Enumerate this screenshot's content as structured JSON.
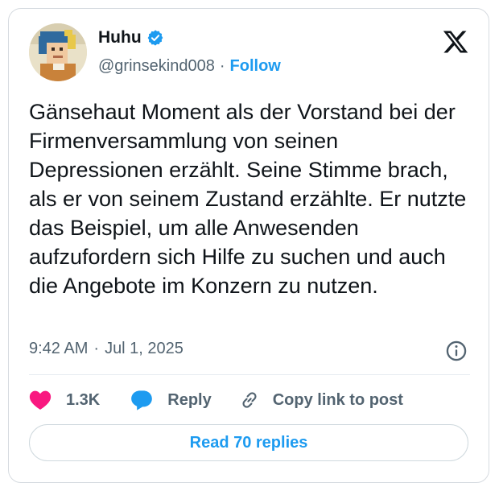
{
  "author": {
    "display_name": "Huhu",
    "handle": "@grinsekind008",
    "separator": "·",
    "follow_label": "Follow",
    "verified_color": "#1d9bf0"
  },
  "tweet": {
    "text": "Gänsehaut Moment als der Vorstand bei der Firmenversammlung von seinen Depressionen erzählt. Seine Stimme brach, als er von seinem Zustand erzählte. Er nutzte das Beispiel, um alle Anwesenden aufzufordern sich Hilfe zu suchen und auch die Angebote im Konzern zu nutzen.",
    "time": "9:42 AM",
    "separator": "·",
    "date": "Jul 1, 2025"
  },
  "actions": {
    "like_count": "1.3K",
    "reply_label": "Reply",
    "copy_label": "Copy link to post"
  },
  "read_replies_label": "Read 70 replies",
  "icons": {
    "logo": "x-logo-icon",
    "verified": "verified-badge-icon",
    "info": "info-icon",
    "like": "heart-icon",
    "reply": "speech-bubble-icon",
    "copy": "link-icon"
  },
  "colors": {
    "accent": "#1d9bf0",
    "like": "#f91880",
    "text": "#0f1419",
    "secondary": "#536471"
  }
}
